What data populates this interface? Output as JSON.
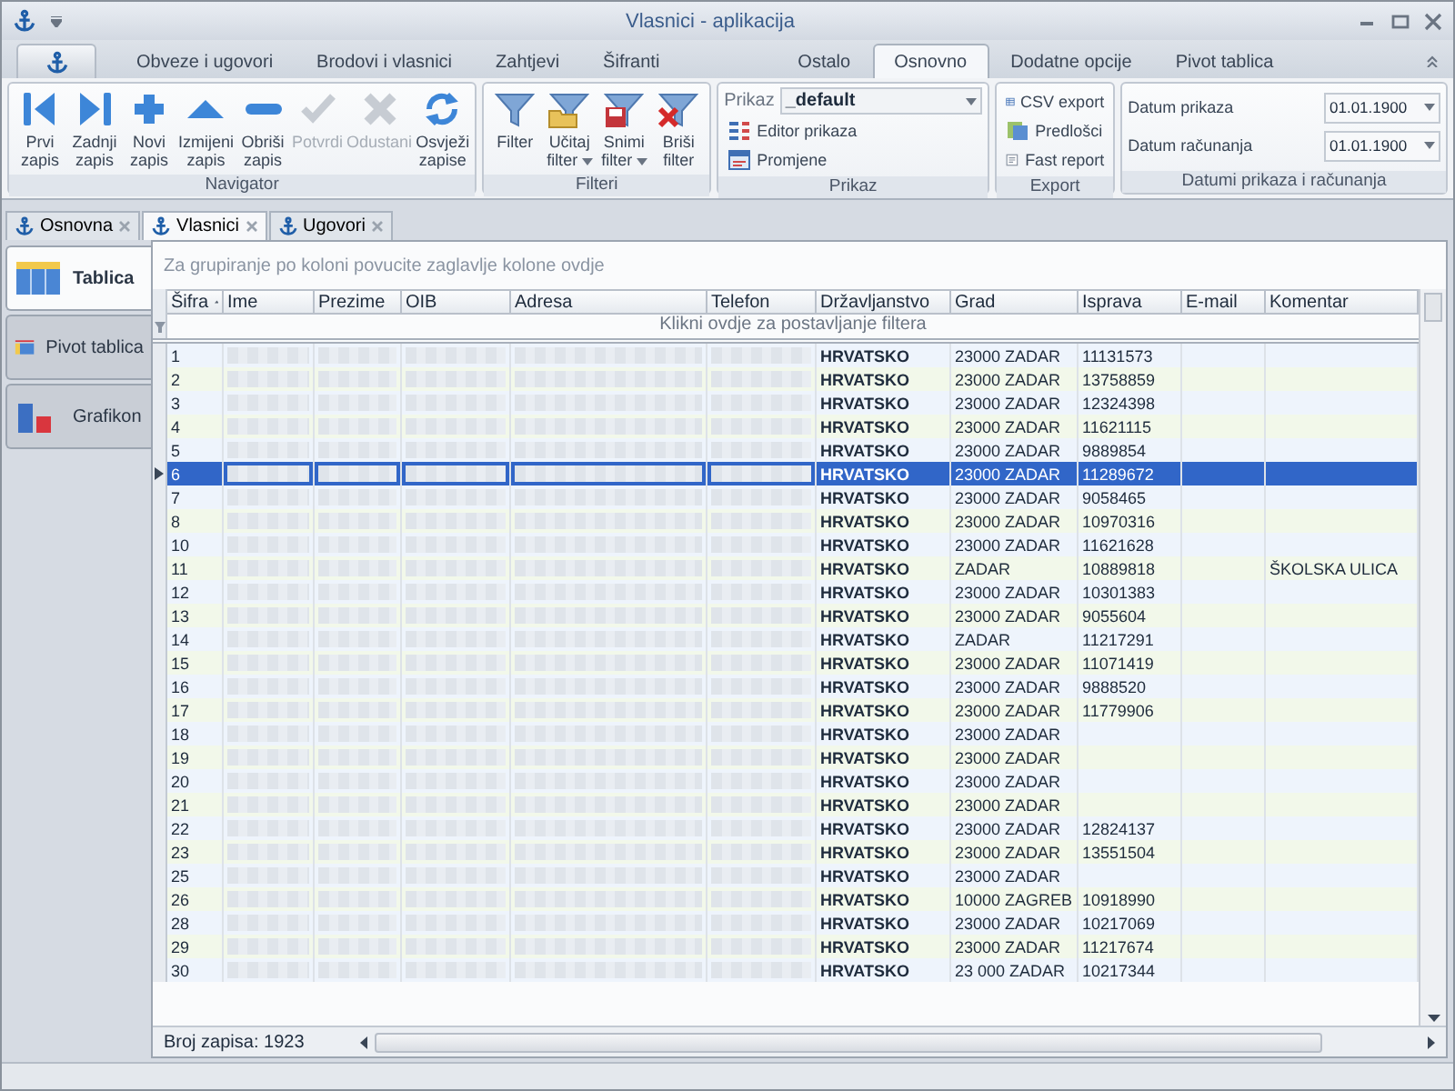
{
  "window": {
    "title": "Vlasnici - aplikacija"
  },
  "ribbon": {
    "tabs": [
      {
        "label": "Obveze i ugovori",
        "selected": false
      },
      {
        "label": "Brodovi i vlasnici",
        "selected": false
      },
      {
        "label": "Zahtjevi",
        "selected": false
      },
      {
        "label": "Šifranti",
        "selected": false
      }
    ],
    "context_tabs": [
      {
        "label": "Ostalo",
        "selected": false
      },
      {
        "label": "Osnovno",
        "selected": true
      },
      {
        "label": "Dodatne opcije",
        "selected": false
      },
      {
        "label": "Pivot tablica",
        "selected": false
      }
    ],
    "navigator": {
      "title": "Navigator",
      "buttons": [
        {
          "kind": "first",
          "label": "Prvi zapis",
          "disabled": false
        },
        {
          "kind": "last",
          "label": "Zadnji zapis",
          "disabled": false
        },
        {
          "kind": "add",
          "label": "Novi zapis",
          "disabled": false
        },
        {
          "kind": "edit",
          "label": "Izmijeni zapis",
          "disabled": false
        },
        {
          "kind": "delete",
          "label": "Obriši zapis",
          "disabled": false
        },
        {
          "kind": "confirm",
          "label": "Potvrdi",
          "disabled": true
        },
        {
          "kind": "cancel",
          "label": "Odustani",
          "disabled": true
        },
        {
          "kind": "refresh",
          "label": "Osvježi zapise",
          "disabled": false
        }
      ]
    },
    "filters": {
      "title": "Filteri",
      "buttons": [
        {
          "kind": "filter",
          "label": "Filter",
          "menu": false
        },
        {
          "kind": "load",
          "label": "Učitaj filter",
          "menu": true
        },
        {
          "kind": "save",
          "label": "Snimi filter",
          "menu": true
        },
        {
          "kind": "clear",
          "label": "Briši filter",
          "menu": false
        }
      ]
    },
    "view": {
      "title": "Prikaz",
      "label": "Prikaz",
      "value": "_default",
      "items": [
        "Editor prikaza",
        "Promjene"
      ]
    },
    "export": {
      "title": "Export",
      "items": [
        {
          "kind": "csv",
          "label": "CSV export"
        },
        {
          "kind": "templates",
          "label": "Predlošci"
        },
        {
          "kind": "report",
          "label": "Fast report"
        }
      ]
    },
    "dates": {
      "title": "Datumi prikaza i računanja",
      "fields": [
        {
          "label": "Datum prikaza",
          "value": "01.01.1900"
        },
        {
          "label": "Datum računanja",
          "value": "01.01.1900"
        }
      ]
    }
  },
  "doc_tabs": [
    {
      "label": "Osnovna",
      "selected": false
    },
    {
      "label": "Vlasnici",
      "selected": true
    },
    {
      "label": "Ugovori",
      "selected": false
    }
  ],
  "side_tabs": [
    {
      "kind": "table",
      "label": "Tablica",
      "selected": true
    },
    {
      "kind": "pivot",
      "label": "Pivot tablica",
      "selected": false
    },
    {
      "kind": "chart",
      "label": "Grafikon",
      "selected": false
    }
  ],
  "grid": {
    "group_hint": "Za grupiranje po koloni povucite zaglavlje kolone ovdje",
    "filter_hint": "Klikni ovdje za postavljanje filtera",
    "record_count": "Broj zapisa: 1923",
    "columns": [
      {
        "label": "Šifra",
        "blurred": false,
        "sorted": true
      },
      {
        "label": "Ime",
        "blurred": true,
        "sorted": false
      },
      {
        "label": "Prezime",
        "blurred": true,
        "sorted": false
      },
      {
        "label": "OIB",
        "blurred": true,
        "sorted": false
      },
      {
        "label": "Adresa",
        "blurred": true,
        "sorted": false
      },
      {
        "label": "Telefon",
        "blurred": true,
        "sorted": false
      },
      {
        "label": "Državljanstvo",
        "blurred": false,
        "sorted": false
      },
      {
        "label": "Grad",
        "blurred": false,
        "sorted": false
      },
      {
        "label": "Isprava",
        "blurred": false,
        "sorted": false
      },
      {
        "label": "E-mail",
        "blurred": false,
        "sorted": false
      },
      {
        "label": "Komentar",
        "blurred": false,
        "sorted": false
      }
    ],
    "rows": [
      {
        "selected": false,
        "sifra": "1",
        "drzavljanstvo": "HRVATSKO",
        "grad": "23000 ZADAR",
        "isprava": "11131573"
      },
      {
        "selected": false,
        "sifra": "2",
        "drzavljanstvo": "HRVATSKO",
        "grad": "23000 ZADAR",
        "isprava": "13758859"
      },
      {
        "selected": false,
        "sifra": "3",
        "drzavljanstvo": "HRVATSKO",
        "grad": "23000 ZADAR",
        "isprava": "12324398"
      },
      {
        "selected": false,
        "sifra": "4",
        "drzavljanstvo": "HRVATSKO",
        "grad": "23000 ZADAR",
        "isprava": "11621115"
      },
      {
        "selected": false,
        "sifra": "5",
        "drzavljanstvo": "HRVATSKO",
        "grad": "23000 ZADAR",
        "isprava": "9889854"
      },
      {
        "selected": true,
        "sifra": "6",
        "drzavljanstvo": "HRVATSKO",
        "grad": "23000 ZADAR",
        "isprava": "11289672"
      },
      {
        "selected": false,
        "sifra": "7",
        "drzavljanstvo": "HRVATSKO",
        "grad": "23000 ZADAR",
        "isprava": "9058465"
      },
      {
        "selected": false,
        "sifra": "8",
        "drzavljanstvo": "HRVATSKO",
        "grad": "23000 ZADAR",
        "isprava": "10970316"
      },
      {
        "selected": false,
        "sifra": "10",
        "drzavljanstvo": "HRVATSKO",
        "grad": "23000 ZADAR",
        "isprava": "11621628"
      },
      {
        "selected": false,
        "sifra": "11",
        "drzavljanstvo": "HRVATSKO",
        "grad": "ZADAR",
        "isprava": "10889818",
        "komentar": "ŠKOLSKA ULICA"
      },
      {
        "selected": false,
        "sifra": "12",
        "drzavljanstvo": "HRVATSKO",
        "grad": "23000 ZADAR",
        "isprava": "10301383"
      },
      {
        "selected": false,
        "sifra": "13",
        "drzavljanstvo": "HRVATSKO",
        "grad": "23000 ZADAR",
        "isprava": "9055604"
      },
      {
        "selected": false,
        "sifra": "14",
        "drzavljanstvo": "HRVATSKO",
        "grad": "ZADAR",
        "isprava": "11217291"
      },
      {
        "selected": false,
        "sifra": "15",
        "drzavljanstvo": "HRVATSKO",
        "grad": "23000 ZADAR",
        "isprava": "11071419"
      },
      {
        "selected": false,
        "sifra": "16",
        "drzavljanstvo": "HRVATSKO",
        "grad": "23000 ZADAR",
        "isprava": "9888520"
      },
      {
        "selected": false,
        "sifra": "17",
        "drzavljanstvo": "HRVATSKO",
        "grad": "23000 ZADAR",
        "isprava": "11779906"
      },
      {
        "selected": false,
        "sifra": "18",
        "drzavljanstvo": "HRVATSKO",
        "grad": "23000 ZADAR"
      },
      {
        "selected": false,
        "sifra": "19",
        "drzavljanstvo": "HRVATSKO",
        "grad": "23000 ZADAR"
      },
      {
        "selected": false,
        "sifra": "20",
        "drzavljanstvo": "HRVATSKO",
        "grad": "23000 ZADAR"
      },
      {
        "selected": false,
        "sifra": "21",
        "drzavljanstvo": "HRVATSKO",
        "grad": "23000 ZADAR"
      },
      {
        "selected": false,
        "sifra": "22",
        "drzavljanstvo": "HRVATSKO",
        "grad": "23000 ZADAR",
        "isprava": "12824137"
      },
      {
        "selected": false,
        "sifra": "23",
        "drzavljanstvo": "HRVATSKO",
        "grad": "23000 ZADAR",
        "isprava": "13551504"
      },
      {
        "selected": false,
        "sifra": "25",
        "drzavljanstvo": "HRVATSKO",
        "grad": "23000 ZADAR"
      },
      {
        "selected": false,
        "sifra": "26",
        "drzavljanstvo": "HRVATSKO",
        "grad": "10000 ZAGREB",
        "isprava": "10918990"
      },
      {
        "selected": false,
        "sifra": "28",
        "drzavljanstvo": "HRVATSKO",
        "grad": "23000 ZADAR",
        "isprava": "10217069"
      },
      {
        "selected": false,
        "sifra": "29",
        "drzavljanstvo": "HRVATSKO",
        "grad": "23000 ZADAR",
        "isprava": "11217674"
      },
      {
        "selected": false,
        "sifra": "30",
        "drzavljanstvo": "HRVATSKO",
        "grad": "23 000 ZADAR",
        "isprava": "10217344"
      }
    ]
  }
}
